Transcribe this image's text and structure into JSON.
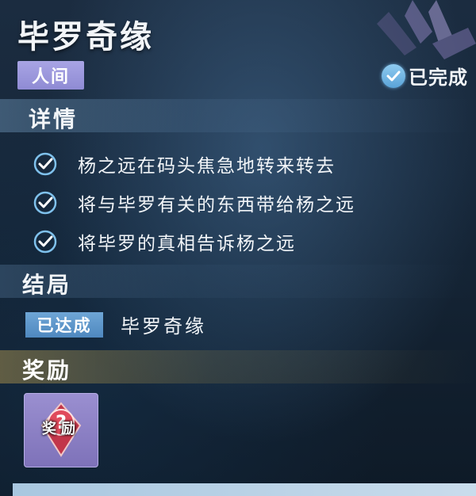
{
  "quest": {
    "title": "毕罗奇缘",
    "realm_tag": "人间",
    "status": {
      "icon": "check-circle-icon",
      "label": "已完成"
    }
  },
  "details": {
    "heading": "详情",
    "objectives": [
      {
        "icon": "check-icon",
        "text": "杨之远在码头焦急地转来转去"
      },
      {
        "icon": "check-icon",
        "text": "将与毕罗有关的东西带给杨之远"
      },
      {
        "icon": "check-icon",
        "text": "将毕罗的真相告诉杨之远"
      }
    ]
  },
  "ending": {
    "heading": "结局",
    "badge": "已达成",
    "name": "毕罗奇缘"
  },
  "reward": {
    "heading": "奖励",
    "items": [
      {
        "icon": "mystery-reward-icon",
        "label": "奖励"
      }
    ]
  },
  "colors": {
    "realm_tag": "#9f9be0",
    "ending_badge": "#5e97cc",
    "check": "#7fc1ec",
    "reward_accent": "#c9a85a"
  }
}
